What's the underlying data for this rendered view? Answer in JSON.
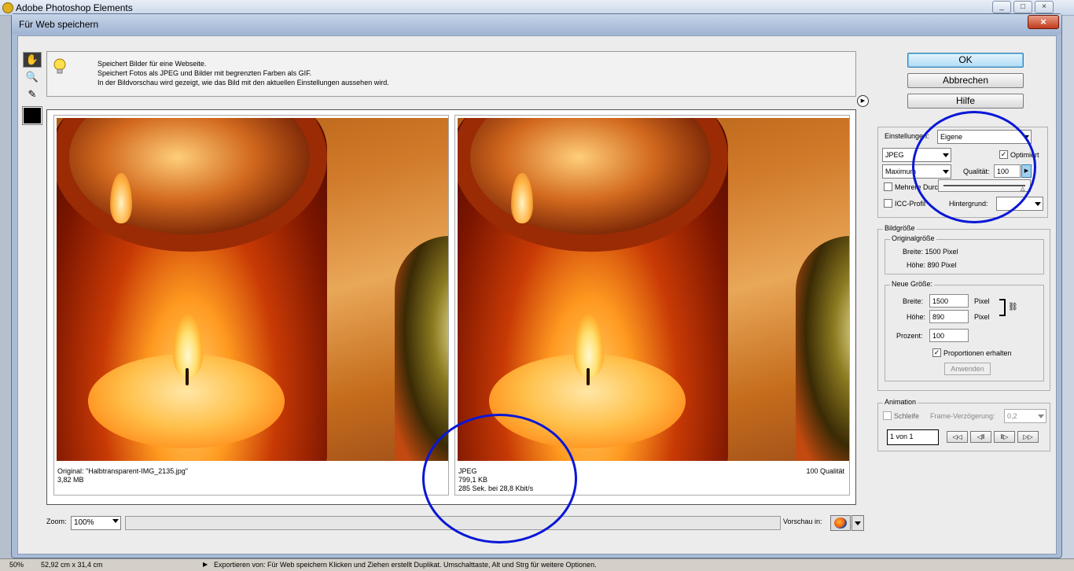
{
  "app": {
    "title": "Adobe Photoshop Elements"
  },
  "dialog": {
    "title": "Für Web speichern",
    "info": [
      "Speichert Bilder für eine Webseite.",
      "Speichert Fotos als JPEG und Bilder mit begrenzten Farben als GIF.",
      "In der Bildvorschau wird gezeigt, wie das Bild mit den aktuellen Einstellungen aussehen wird."
    ]
  },
  "buttons": {
    "ok": "OK",
    "cancel": "Abbrechen",
    "help": "Hilfe"
  },
  "preview": {
    "left": {
      "line1": "Original: \"Halbtransparent-IMG_2135.jpg\"",
      "line2": "3,82 MB"
    },
    "right": {
      "format": "JPEG",
      "size": "799,1 KB",
      "time": "285 Sek. bei 28,8 Kbit/s",
      "quality": "100 Qualität"
    }
  },
  "zoom": {
    "label": "Zoom:",
    "value": "100%"
  },
  "preview_in": {
    "label": "Vorschau in:"
  },
  "settings": {
    "label": "Einstellungen:",
    "preset": "Eigene",
    "format": "JPEG",
    "compression": "Maximum",
    "optimized_label": "Optimiert",
    "optimized": true,
    "quality_label": "Qualität:",
    "quality": "100",
    "multiple_pass_label": "Mehrere Durchgänge",
    "icc_label": "ICC-Profil",
    "background_label": "Hintergrund:"
  },
  "image_size": {
    "label": "Bildgröße",
    "original_label": "Originalgröße",
    "orig_width": "Breite: 1500 Pixel",
    "orig_height": "Höhe: 890 Pixel",
    "new_label": "Neue Größe:",
    "width_label": "Breite:",
    "width": "1500",
    "height_label": "Höhe:",
    "height": "890",
    "unit": "Pixel",
    "percent_label": "Prozent:",
    "percent": "100",
    "constrain_label": "Proportionen erhalten",
    "apply": "Anwenden"
  },
  "animation": {
    "label": "Animation",
    "loop_label": "Schleife",
    "delay_label": "Frame-Verzögerung:",
    "delay": "0,2",
    "frame": "1 von 1",
    "controls": [
      "◁◁",
      "◁‖",
      "‖▷",
      "▷▷"
    ]
  },
  "statusbar": {
    "zoom": "50%",
    "dims": "52,92 cm x 31,4 cm",
    "msg": "Exportieren von: Für Web speichern    Klicken und Ziehen erstellt Duplikat. Umschalttaste, Alt und Strg für weitere Optionen."
  },
  "colors": {
    "annotation": "#0a17d6",
    "ok_button": "#b0dbf5"
  }
}
